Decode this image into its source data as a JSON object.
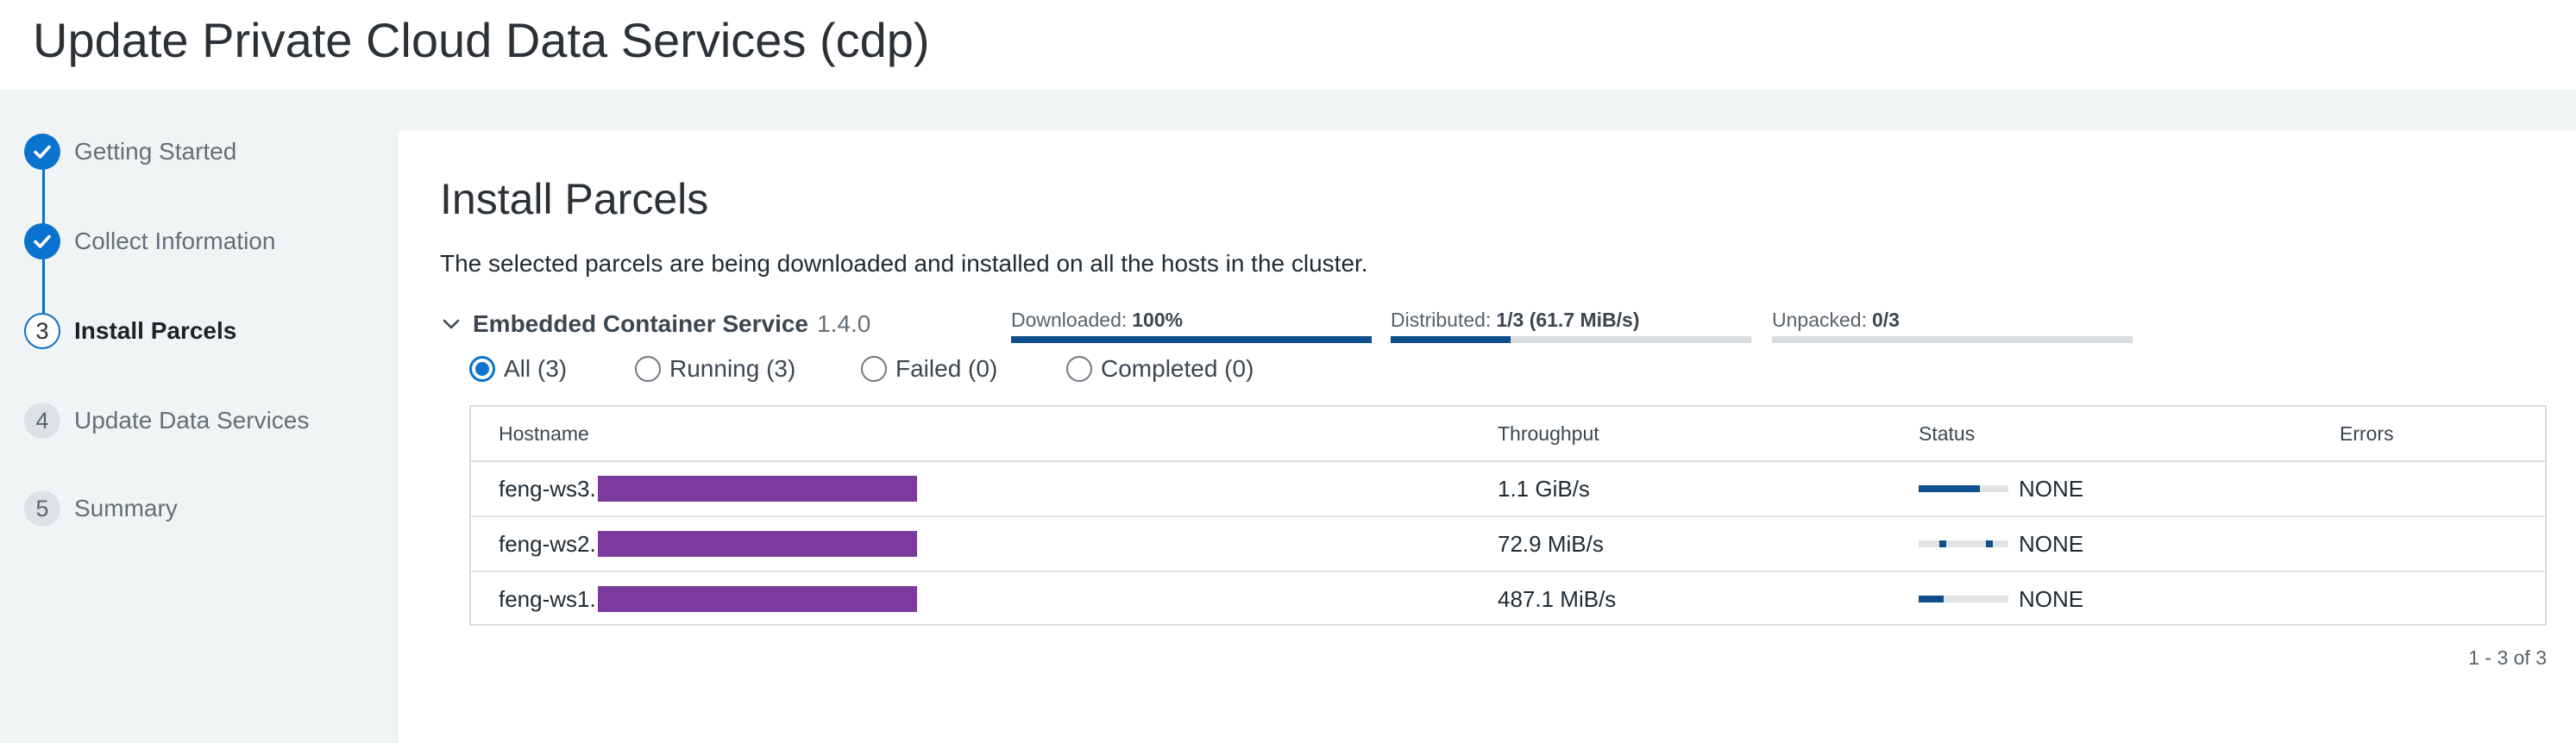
{
  "page": {
    "title": "Update Private Cloud Data Services (cdp)"
  },
  "wizard": {
    "steps": [
      {
        "marker": "",
        "label": "Getting Started",
        "state": "done"
      },
      {
        "marker": "",
        "label": "Collect Information",
        "state": "done"
      },
      {
        "marker": "3",
        "label": "Install Parcels",
        "state": "current"
      },
      {
        "marker": "4",
        "label": "Update Data Services",
        "state": "todo"
      },
      {
        "marker": "5",
        "label": "Summary",
        "state": "todo"
      }
    ],
    "done_icon": "check-icon"
  },
  "main": {
    "title": "Install Parcels",
    "description": "The selected parcels are being downloaded and installed on all the hosts in the cluster.",
    "parcel": {
      "name": "Embedded Container Service",
      "version": "1.4.0",
      "expand_icon": "chevron-down-icon",
      "progress": [
        {
          "label": "Downloaded:",
          "value": "100%",
          "fill": 1.0
        },
        {
          "label": "Distributed:",
          "value": "1/3 (61.7 MiB/s)",
          "fill": 0.333
        },
        {
          "label": "Unpacked:",
          "value": "0/3",
          "fill": 0.0
        }
      ]
    },
    "filters": [
      {
        "label": "All (3)",
        "checked": true
      },
      {
        "label": "Running (3)",
        "checked": false
      },
      {
        "label": "Failed (0)",
        "checked": false
      },
      {
        "label": "Completed (0)",
        "checked": false
      }
    ],
    "table": {
      "columns": [
        "Hostname",
        "Throughput",
        "Status",
        "Errors"
      ],
      "rows": [
        {
          "hostname": "feng-ws3.",
          "throughput": "1.1 GiB/s",
          "status": "NONE",
          "progress": 0.68,
          "errors": ""
        },
        {
          "hostname": "feng-ws2.",
          "throughput": "72.9 MiB/s",
          "status": "NONE",
          "progress": null,
          "errors": ""
        },
        {
          "hostname": "feng-ws1.",
          "throughput": "487.1 MiB/s",
          "status": "NONE",
          "progress": 0.28,
          "errors": ""
        }
      ]
    },
    "pagination": "1 - 3 of 3"
  },
  "colors": {
    "accent": "#0a73d0",
    "progress_fill": "#0d4f8b",
    "redaction": "#7b3b9e",
    "sidebar_bg": "#f1f4f5"
  }
}
